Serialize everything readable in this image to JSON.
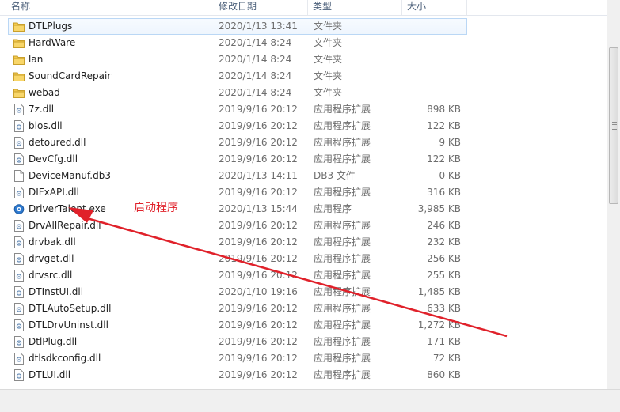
{
  "columns": {
    "name": "名称",
    "date": "修改日期",
    "type": "类型",
    "size": "大小"
  },
  "files": [
    {
      "name": "DTLPlugs",
      "date": "2020/1/13 13:41",
      "type": "文件夹",
      "size": "",
      "icon": "folder-icon",
      "selected": true
    },
    {
      "name": "HardWare",
      "date": "2020/1/14 8:24",
      "type": "文件夹",
      "size": "",
      "icon": "folder-icon"
    },
    {
      "name": "lan",
      "date": "2020/1/14 8:24",
      "type": "文件夹",
      "size": "",
      "icon": "folder-icon"
    },
    {
      "name": "SoundCardRepair",
      "date": "2020/1/14 8:24",
      "type": "文件夹",
      "size": "",
      "icon": "folder-icon"
    },
    {
      "name": "webad",
      "date": "2020/1/14 8:24",
      "type": "文件夹",
      "size": "",
      "icon": "folder-icon"
    },
    {
      "name": "7z.dll",
      "date": "2019/9/16 20:12",
      "type": "应用程序扩展",
      "size": "898 KB",
      "icon": "dll-icon"
    },
    {
      "name": "bios.dll",
      "date": "2019/9/16 20:12",
      "type": "应用程序扩展",
      "size": "122 KB",
      "icon": "dll-icon"
    },
    {
      "name": "detoured.dll",
      "date": "2019/9/16 20:12",
      "type": "应用程序扩展",
      "size": "9 KB",
      "icon": "dll-icon"
    },
    {
      "name": "DevCfg.dll",
      "date": "2019/9/16 20:12",
      "type": "应用程序扩展",
      "size": "122 KB",
      "icon": "dll-icon"
    },
    {
      "name": "DeviceManuf.db3",
      "date": "2020/1/13 14:11",
      "type": "DB3 文件",
      "size": "0 KB",
      "icon": "blank-file-icon"
    },
    {
      "name": "DIFxAPI.dll",
      "date": "2019/9/16 20:12",
      "type": "应用程序扩展",
      "size": "316 KB",
      "icon": "dll-icon"
    },
    {
      "name": "DriverTalent.exe",
      "date": "2020/1/13 15:44",
      "type": "应用程序",
      "size": "3,985 KB",
      "icon": "app-icon"
    },
    {
      "name": "DrvAllRepair.dll",
      "date": "2019/9/16 20:12",
      "type": "应用程序扩展",
      "size": "246 KB",
      "icon": "dll-icon"
    },
    {
      "name": "drvbak.dll",
      "date": "2019/9/16 20:12",
      "type": "应用程序扩展",
      "size": "232 KB",
      "icon": "dll-icon"
    },
    {
      "name": "drvget.dll",
      "date": "2019/9/16 20:12",
      "type": "应用程序扩展",
      "size": "256 KB",
      "icon": "dll-icon"
    },
    {
      "name": "drvsrc.dll",
      "date": "2019/9/16 20:12",
      "type": "应用程序扩展",
      "size": "255 KB",
      "icon": "dll-icon"
    },
    {
      "name": "DTInstUI.dll",
      "date": "2020/1/10 19:16",
      "type": "应用程序扩展",
      "size": "1,485 KB",
      "icon": "dll-icon"
    },
    {
      "name": "DTLAutoSetup.dll",
      "date": "2019/9/16 20:12",
      "type": "应用程序扩展",
      "size": "633 KB",
      "icon": "dll-icon"
    },
    {
      "name": "DTLDrvUninst.dll",
      "date": "2019/9/16 20:12",
      "type": "应用程序扩展",
      "size": "1,272 KB",
      "icon": "dll-icon"
    },
    {
      "name": "DtlPlug.dll",
      "date": "2019/9/16 20:12",
      "type": "应用程序扩展",
      "size": "171 KB",
      "icon": "dll-icon"
    },
    {
      "name": "dtlsdkconfig.dll",
      "date": "2019/9/16 20:12",
      "type": "应用程序扩展",
      "size": "72 KB",
      "icon": "dll-icon"
    },
    {
      "name": "DTLUI.dll",
      "date": "2019/9/16 20:12",
      "type": "应用程序扩展",
      "size": "860 KB",
      "icon": "dll-icon"
    }
  ],
  "annotation": {
    "text": "启动程序",
    "color": "#e0212a"
  },
  "colors": {
    "header_text": "#4c607a",
    "selection_border": "#bad7f5",
    "folder": "#f3c94b"
  }
}
